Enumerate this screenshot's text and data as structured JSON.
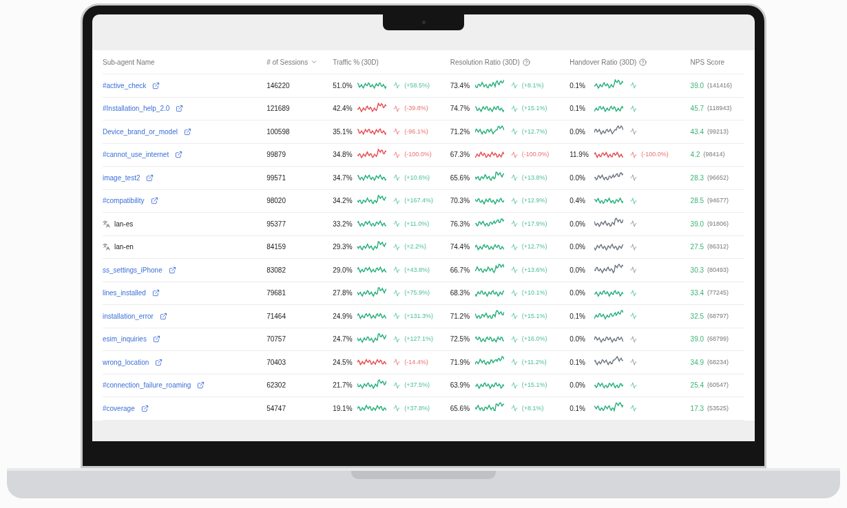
{
  "columns": [
    {
      "label": "Sub-agent Name",
      "sorted": false,
      "help": false
    },
    {
      "label": "# of Sessions",
      "sorted": true,
      "help": false
    },
    {
      "label": "Traffic % (30D)",
      "sorted": false,
      "help": false
    },
    {
      "label": "Resolution Ratio (30D)",
      "sorted": false,
      "help": true
    },
    {
      "label": "Handover Ratio (30D)",
      "sorted": false,
      "help": true
    },
    {
      "label": "NPS Score",
      "sorted": false,
      "help": false
    }
  ],
  "rows": [
    {
      "name": "#active_check",
      "kind": "link",
      "sessions": "146220",
      "traffic": {
        "value": "51.0%",
        "color": "#1fae77",
        "change": "(+58.5%)"
      },
      "resolution": {
        "value": "73.4%",
        "color": "#1fae77",
        "change": "(+8.1%)"
      },
      "handover": {
        "value": "0.1%",
        "color": "#1fae77"
      },
      "nps": {
        "score": "39.0",
        "count": "(141416)"
      }
    },
    {
      "name": "#Installation_help_2.0",
      "kind": "link",
      "sessions": "121689",
      "traffic": {
        "value": "42.4%",
        "color": "#e5484d",
        "change": "(-39.8%)"
      },
      "resolution": {
        "value": "74.7%",
        "color": "#1fae77",
        "change": "(+15.1%)"
      },
      "handover": {
        "value": "0.1%",
        "color": "#1fae77"
      },
      "nps": {
        "score": "45.7",
        "count": "(118943)"
      }
    },
    {
      "name": "Device_brand_or_model",
      "kind": "link",
      "sessions": "100598",
      "traffic": {
        "value": "35.1%",
        "color": "#e5484d",
        "change": "(-96.1%)"
      },
      "resolution": {
        "value": "71.2%",
        "color": "#1fae77",
        "change": "(+12.7%)"
      },
      "handover": {
        "value": "0.0%",
        "color": "#6b7280"
      },
      "nps": {
        "score": "43.4",
        "count": "(99213)"
      }
    },
    {
      "name": "#cannot_use_internet",
      "kind": "link",
      "sessions": "99879",
      "traffic": {
        "value": "34.8%",
        "color": "#e5484d",
        "change": "(-100.0%)"
      },
      "resolution": {
        "value": "67.3%",
        "color": "#e5484d",
        "change": "(-100.0%)"
      },
      "handover": {
        "value": "11.9%",
        "color": "#e5484d",
        "change": "(-100.0%)"
      },
      "nps": {
        "score": "4.2",
        "count": "(98414)"
      }
    },
    {
      "name": "image_test2",
      "kind": "link",
      "sessions": "99571",
      "traffic": {
        "value": "34.7%",
        "color": "#1fae77",
        "change": "(+10.6%)"
      },
      "resolution": {
        "value": "65.6%",
        "color": "#1fae77",
        "change": "(+13.8%)"
      },
      "handover": {
        "value": "0.0%",
        "color": "#6b7280"
      },
      "nps": {
        "score": "28.3",
        "count": "(96652)"
      }
    },
    {
      "name": "#compatibility",
      "kind": "link",
      "sessions": "98020",
      "traffic": {
        "value": "34.2%",
        "color": "#1fae77",
        "change": "(+167.4%)"
      },
      "resolution": {
        "value": "70.3%",
        "color": "#1fae77",
        "change": "(+12.9%)"
      },
      "handover": {
        "value": "0.4%",
        "color": "#1fae77"
      },
      "nps": {
        "score": "28.5",
        "count": "(94677)"
      }
    },
    {
      "name": "lan-es",
      "kind": "language",
      "sessions": "95377",
      "traffic": {
        "value": "33.2%",
        "color": "#1fae77",
        "change": "(+11.0%)"
      },
      "resolution": {
        "value": "76.3%",
        "color": "#1fae77",
        "change": "(+17.9%)"
      },
      "handover": {
        "value": "0.0%",
        "color": "#6b7280"
      },
      "nps": {
        "score": "39.0",
        "count": "(91806)"
      }
    },
    {
      "name": "lan-en",
      "kind": "language",
      "sessions": "84159",
      "traffic": {
        "value": "29.3%",
        "color": "#1fae77",
        "change": "(+2.2%)"
      },
      "resolution": {
        "value": "74.4%",
        "color": "#1fae77",
        "change": "(+12.7%)"
      },
      "handover": {
        "value": "0.0%",
        "color": "#6b7280"
      },
      "nps": {
        "score": "27.5",
        "count": "(86312)"
      }
    },
    {
      "name": "ss_settings_iPhone",
      "kind": "link",
      "sessions": "83082",
      "traffic": {
        "value": "29.0%",
        "color": "#1fae77",
        "change": "(+43.8%)"
      },
      "resolution": {
        "value": "66.7%",
        "color": "#1fae77",
        "change": "(+13.6%)"
      },
      "handover": {
        "value": "0.0%",
        "color": "#6b7280"
      },
      "nps": {
        "score": "30.3",
        "count": "(80493)"
      }
    },
    {
      "name": "lines_installed",
      "kind": "link",
      "sessions": "79681",
      "traffic": {
        "value": "27.8%",
        "color": "#1fae77",
        "change": "(+75.9%)"
      },
      "resolution": {
        "value": "68.3%",
        "color": "#1fae77",
        "change": "(+10.1%)"
      },
      "handover": {
        "value": "0.0%",
        "color": "#1fae77"
      },
      "nps": {
        "score": "33.4",
        "count": "(77245)"
      }
    },
    {
      "name": "installation_error",
      "kind": "link",
      "sessions": "71464",
      "traffic": {
        "value": "24.9%",
        "color": "#1fae77",
        "change": "(+131.3%)"
      },
      "resolution": {
        "value": "71.2%",
        "color": "#1fae77",
        "change": "(+15.1%)"
      },
      "handover": {
        "value": "0.1%",
        "color": "#1fae77"
      },
      "nps": {
        "score": "32.5",
        "count": "(68797)"
      }
    },
    {
      "name": "esim_inquiries",
      "kind": "link",
      "sessions": "70757",
      "traffic": {
        "value": "24.7%",
        "color": "#1fae77",
        "change": "(+127.1%)"
      },
      "resolution": {
        "value": "72.5%",
        "color": "#1fae77",
        "change": "(+16.0%)"
      },
      "handover": {
        "value": "0.0%",
        "color": "#6b7280"
      },
      "nps": {
        "score": "39.0",
        "count": "(68799)"
      }
    },
    {
      "name": "wrong_location",
      "kind": "link",
      "sessions": "70403",
      "traffic": {
        "value": "24.5%",
        "color": "#e5484d",
        "change": "(-14.4%)"
      },
      "resolution": {
        "value": "71.9%",
        "color": "#1fae77",
        "change": "(+11.2%)"
      },
      "handover": {
        "value": "0.1%",
        "color": "#6b7280"
      },
      "nps": {
        "score": "34.9",
        "count": "(68234)"
      }
    },
    {
      "name": "#connection_failure_roaming",
      "kind": "link",
      "sessions": "62302",
      "traffic": {
        "value": "21.7%",
        "color": "#1fae77",
        "change": "(+37.5%)"
      },
      "resolution": {
        "value": "63.9%",
        "color": "#1fae77",
        "change": "(+15.1%)"
      },
      "handover": {
        "value": "0.0%",
        "color": "#1fae77"
      },
      "nps": {
        "score": "25.4",
        "count": "(60547)"
      }
    },
    {
      "name": "#coverage",
      "kind": "link",
      "sessions": "54747",
      "traffic": {
        "value": "19.1%",
        "color": "#1fae77",
        "change": "(+37.8%)"
      },
      "resolution": {
        "value": "65.6%",
        "color": "#1fae77",
        "change": "(+8.1%)"
      },
      "handover": {
        "value": "0.1%",
        "color": "#1fae77"
      },
      "nps": {
        "score": "17.3",
        "count": "(53525)"
      }
    }
  ]
}
